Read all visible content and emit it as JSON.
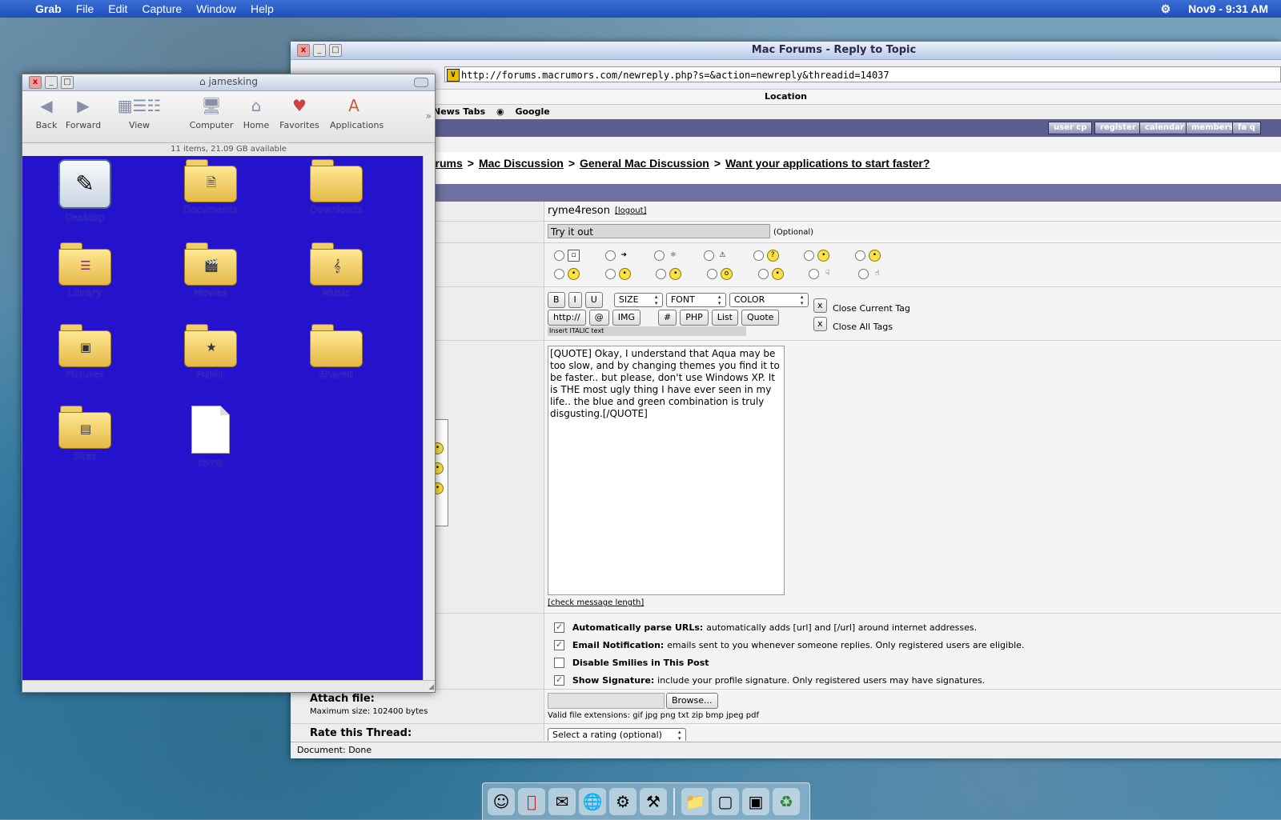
{
  "menubar": {
    "app_name": "Grab",
    "menus": [
      "File",
      "Edit",
      "Capture",
      "Window",
      "Help"
    ],
    "datetime": "Nov9 - 9:31 AM"
  },
  "browser": {
    "title": "Mac Forums - Reply to Topic",
    "url": "http://forums.macrumors.com/newreply.php?s=&action=newreply&threadid=14037",
    "location_label": "Location",
    "bookmarks": [
      "News Tabs",
      "Google"
    ],
    "nav_buttons": [
      "user cp",
      "register",
      "calendar",
      "members",
      "fa q"
    ],
    "breadcrumb": {
      "items": [
        "orums",
        "Mac Discussion",
        "General Mac Discussion",
        "Want your applications to start faster?"
      ],
      "sep": ">"
    },
    "user": {
      "name": "ryme4reson",
      "logout": "[logout]"
    },
    "subject": {
      "value": "Try it out",
      "optional": "(Optional)"
    },
    "toolbar": {
      "b": "B",
      "i": "I",
      "u": "U",
      "size": "SIZE",
      "font": "FONT",
      "color": "COLOR",
      "http": "http://",
      "at": "@",
      "img": "IMG",
      "hash": "#",
      "php": "PHP",
      "list": "List",
      "quote": "Quote",
      "close_current": "Close Current Tag",
      "close_all": "Close All Tags",
      "x": "x",
      "hint": "Insert ITALIC text"
    },
    "message": "[QUOTE] Okay, I understand that Aqua may be too slow, and by changing themes you find it to be faster.. but please, don't use Windows XP. It is THE most ugly thing I have ever seen in my life.. the blue and green combination is truly disgusting.[/QUOTE]",
    "check_length": "[check message length]",
    "options": [
      {
        "label": "Automatically parse URLs:",
        "desc": "automatically adds [url] and [/url] around internet addresses.",
        "checked": true
      },
      {
        "label": "Email Notification:",
        "desc": "emails sent to you whenever someone replies. Only registered users are eligible.",
        "checked": true
      },
      {
        "label": "Disable Smilies in This Post",
        "desc": "",
        "checked": false
      },
      {
        "label": "Show Signature:",
        "desc": "include your profile signature. Only registered users may have signatures.",
        "checked": true
      }
    ],
    "attach": {
      "label": "Attach file:",
      "max_size": "Maximum size: 102400 bytes",
      "browse": "Browse...",
      "extensions": "Valid file extensions: gif jpg png txt zip bmp jpeg pdf"
    },
    "rate": {
      "label": "Rate this Thread:",
      "select": "Select a rating (optional)"
    },
    "status": "Document: Done"
  },
  "finder": {
    "title": "jamesking",
    "toolbar": [
      "Back",
      "Forward",
      "View",
      "Computer",
      "Home",
      "Favorites",
      "Applications"
    ],
    "status": "11 items, 21.09 GB available",
    "items": [
      {
        "label": "Desktop",
        "kind": "desktop"
      },
      {
        "label": "Documents",
        "kind": "folder"
      },
      {
        "label": "Downloads",
        "kind": "folder"
      },
      {
        "label": "Library",
        "kind": "folder"
      },
      {
        "label": "Movies",
        "kind": "folder"
      },
      {
        "label": "Music",
        "kind": "folder"
      },
      {
        "label": "Pictures",
        "kind": "folder"
      },
      {
        "label": "Public",
        "kind": "folder"
      },
      {
        "label": "Shared",
        "kind": "folder"
      },
      {
        "label": "Sites",
        "kind": "folder"
      },
      {
        "label": "temp",
        "kind": "document"
      }
    ]
  }
}
